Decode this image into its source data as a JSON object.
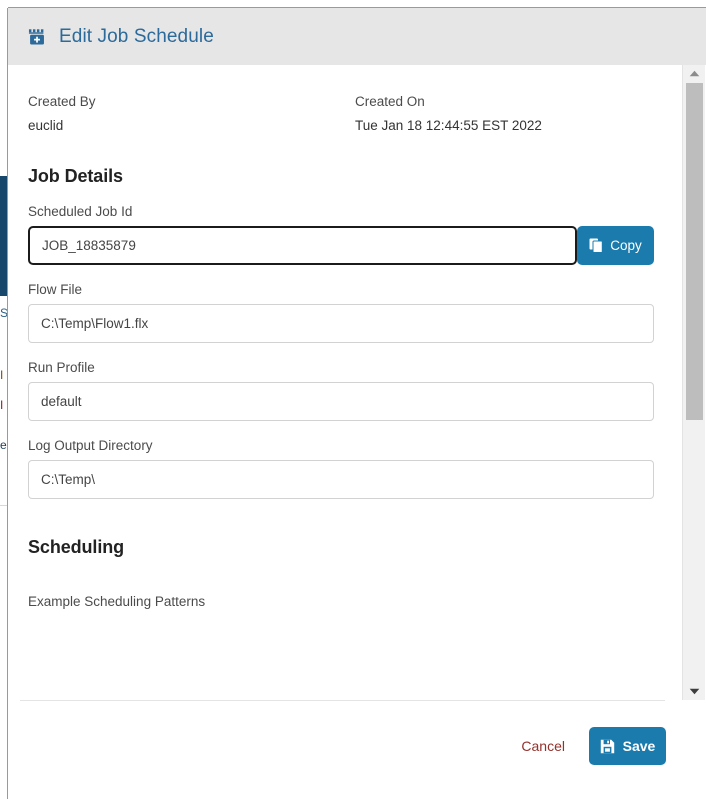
{
  "modal": {
    "title": "Edit Job Schedule",
    "title_icon": "calendar-add-icon",
    "accent_color": "#1c7bad",
    "header_background": "#e6e6e6"
  },
  "meta": {
    "created_by_label": "Created By",
    "created_by_value": "euclid",
    "created_on_label": "Created On",
    "created_on_value": "Tue Jan 18 12:44:55 EST 2022"
  },
  "job_details": {
    "section_title": "Job Details",
    "scheduled_job_id": {
      "label": "Scheduled Job Id",
      "value": "JOB_18835879",
      "copy_label": "Copy",
      "copy_icon": "copy-icon"
    },
    "flow_file": {
      "label": "Flow File",
      "value": "C:\\Temp\\Flow1.flx"
    },
    "run_profile": {
      "label": "Run Profile",
      "value": "default"
    },
    "log_output_directory": {
      "label": "Log Output Directory",
      "value": "C:\\Temp\\"
    }
  },
  "scheduling": {
    "section_title": "Scheduling",
    "example_patterns_label": "Example Scheduling Patterns"
  },
  "scrollbar": {
    "up_arrow_icon": "chevron-up-icon",
    "down_arrow_icon": "chevron-down-icon"
  },
  "footer": {
    "cancel_label": "Cancel",
    "save_label": "Save",
    "save_icon": "save-floppy-icon",
    "cancel_color": "#93322c"
  }
}
